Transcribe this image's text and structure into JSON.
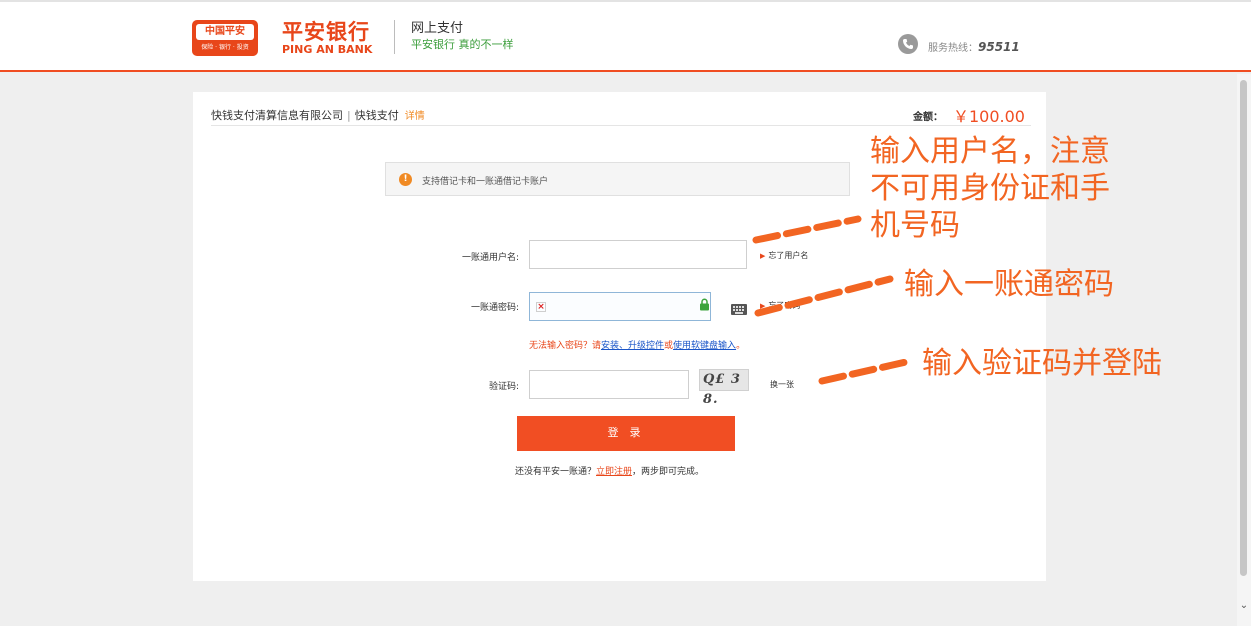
{
  "header": {
    "logo_cp": "中国平安",
    "logo_cp_sub": "保险 · 银行 · 投资",
    "bank_name_cn": "平安银行",
    "bank_name_en": "PING AN BANK",
    "page_title": "网上支付",
    "slogan": "平安银行  真的不一样",
    "hotline_label": "服务热线：",
    "hotline_number": "95511"
  },
  "order": {
    "merchant": "快钱支付清算信息有限公司",
    "channel": "快钱支付",
    "detail_link": "详情",
    "amount_label": "金额：",
    "amount": "￥100.00"
  },
  "form": {
    "notice": "支持借记卡和一账通借记卡账户",
    "username_label": "一账通用户名:",
    "forgot_username": "忘了用户名",
    "password_label": "一账通密码:",
    "forgot_password": "忘了密码",
    "tip_prefix": "无法输入密码？请",
    "tip_install_link": "安装、升级控件",
    "tip_or": "或",
    "tip_keyboard_link": "使用软键盘输入",
    "tip_suffix": "。",
    "captcha_label": "验证码:",
    "captcha_text": "Q£ 3 8.",
    "refresh_captcha": "换一张",
    "login_button": "登 录",
    "register_prefix": "还没有平安一账通？",
    "register_link": "立即注册",
    "register_suffix": "，两步即可完成。"
  },
  "annotations": {
    "username_note_line1": "输入用户名，注意",
    "username_note_line2": "不可用身份证和手",
    "username_note_line3": "机号码",
    "password_note": "输入一账通密码",
    "captcha_note": "输入验证码并登陆"
  },
  "colors": {
    "brand": "#f04d22",
    "annotation": "#f26522",
    "link": "#1a55c8",
    "slogan_green": "#3c9e3c"
  }
}
